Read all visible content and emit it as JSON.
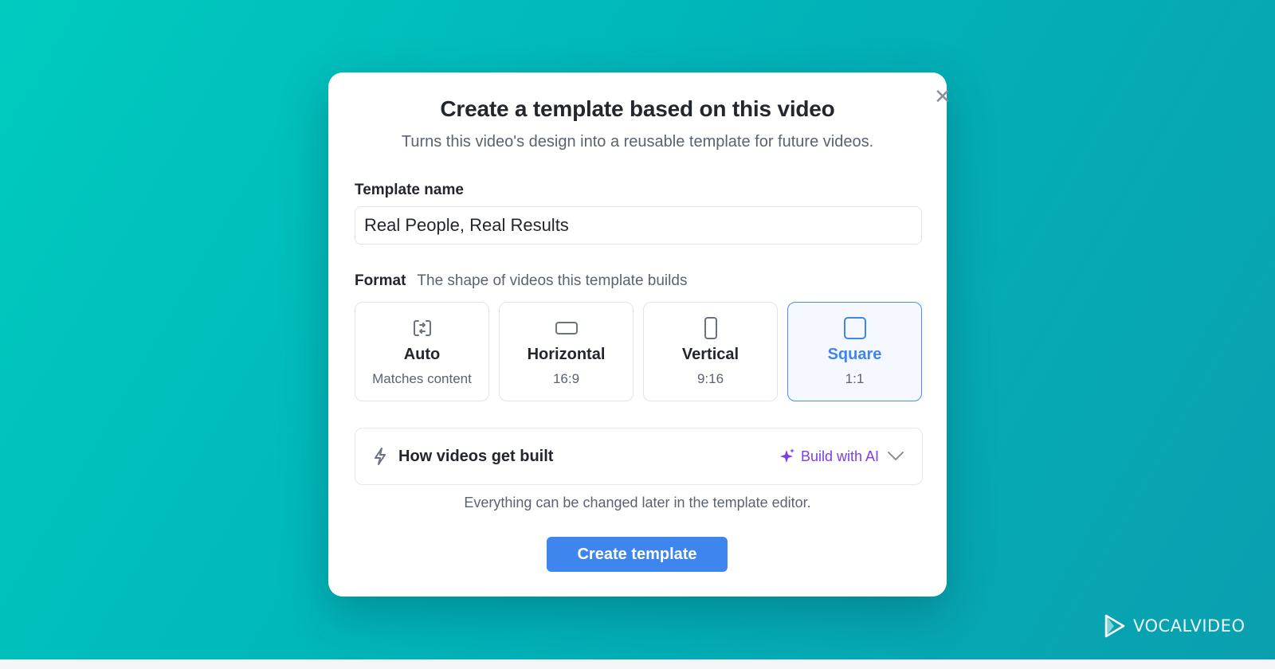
{
  "modal": {
    "title": "Create a template based on this video",
    "subtitle": "Turns this video's design into a reusable template for future videos.",
    "close_icon": "close-icon"
  },
  "template_name": {
    "label": "Template name",
    "value": "Real People, Real Results"
  },
  "format": {
    "label": "Format",
    "hint": "The shape of videos this template builds",
    "selected": "Square",
    "options": [
      {
        "title": "Auto",
        "sub": "Matches content",
        "icon": "auto-resize-icon"
      },
      {
        "title": "Horizontal",
        "sub": "16:9",
        "icon": "horizontal-rectangle-icon"
      },
      {
        "title": "Vertical",
        "sub": "9:16",
        "icon": "vertical-rectangle-icon"
      },
      {
        "title": "Square",
        "sub": "1:1",
        "icon": "square-icon"
      }
    ]
  },
  "build": {
    "label": "How videos get built",
    "value": "Build with AI",
    "icon": "lightning-icon",
    "value_icon": "sparkle-icon"
  },
  "footnote": "Everything can be changed later in the template editor.",
  "create_button": "Create template",
  "brand": {
    "name": "VOCALVIDEO"
  },
  "colors": {
    "accent": "#3f85ee",
    "ai_purple": "#7b3fe4",
    "background": "#00b5b9"
  }
}
